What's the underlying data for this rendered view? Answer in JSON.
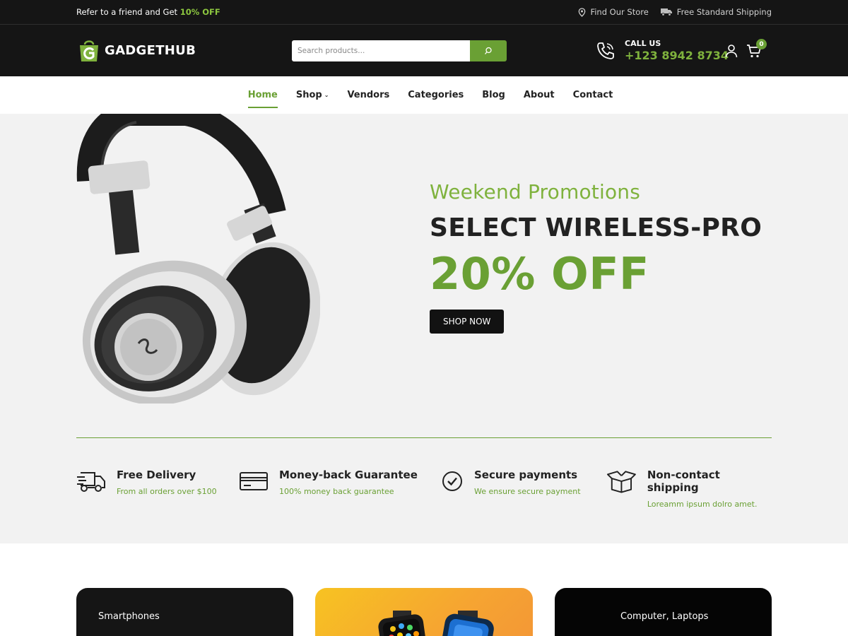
{
  "topbar": {
    "promo_prefix": "Refer to a friend and Get ",
    "promo_highlight": "10% OFF",
    "find_store": "Find Our Store",
    "shipping": "Free Standard Shipping"
  },
  "header": {
    "logo_text": "GADGETHUB",
    "search_placeholder": "Search products...",
    "call_label": "CALL US",
    "call_number": "+123 8942 8734",
    "cart_count": "0"
  },
  "nav": {
    "items": [
      {
        "label": "Home",
        "active": true
      },
      {
        "label": "Shop",
        "has_dropdown": true
      },
      {
        "label": "Vendors"
      },
      {
        "label": "Categories"
      },
      {
        "label": "Blog"
      },
      {
        "label": "About"
      },
      {
        "label": "Contact"
      }
    ],
    "dropdown_glyph": "⌄"
  },
  "hero": {
    "subtitle": "Weekend Promotions",
    "title": "SELECT WIRELESS-PRO",
    "offer": "20% OFF",
    "button": "SHOP NOW"
  },
  "features": [
    {
      "icon": "delivery-truck-icon",
      "title": "Free Delivery",
      "desc": "From all orders over $100"
    },
    {
      "icon": "credit-card-icon",
      "title": "Money-back Guarantee",
      "desc": "100% money back guarantee"
    },
    {
      "icon": "check-circle-icon",
      "title": "Secure payments",
      "desc": "We ensure secure payment"
    },
    {
      "icon": "open-box-icon",
      "title": "Non-contact shipping",
      "desc": "Loreamm ipsum dolro amet."
    }
  ],
  "categories": [
    {
      "title": "Smartphones"
    },
    {
      "title": ""
    },
    {
      "title": "Computer, Laptops"
    }
  ],
  "colors": {
    "accent": "#6aa034",
    "accent_light": "#7fb23d",
    "dark": "#151515",
    "hero_bg": "#f2f2f2"
  }
}
